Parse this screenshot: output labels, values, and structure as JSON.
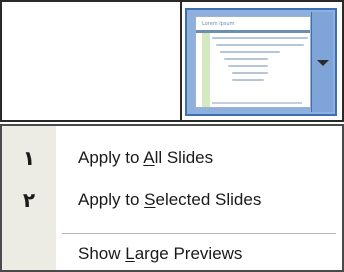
{
  "thumbnail": {
    "slide_title": "Lorem Ipsum",
    "icon": "chevron-down-icon"
  },
  "menu": {
    "items": [
      {
        "number": "١",
        "label_pre": "Apply to ",
        "mnemonic": "A",
        "label_post": "ll Slides"
      },
      {
        "number": "٢",
        "label_pre": "Apply to ",
        "mnemonic": "S",
        "label_post": "elected Slides"
      },
      {
        "number": "",
        "label_pre": "Show ",
        "mnemonic": "L",
        "label_post": "arge Previews"
      }
    ]
  },
  "colors": {
    "thumbnail_border": "#3c6fb5",
    "thumbnail_fill": "#8fb0dc",
    "menu_gutter": "#ecebe4"
  }
}
